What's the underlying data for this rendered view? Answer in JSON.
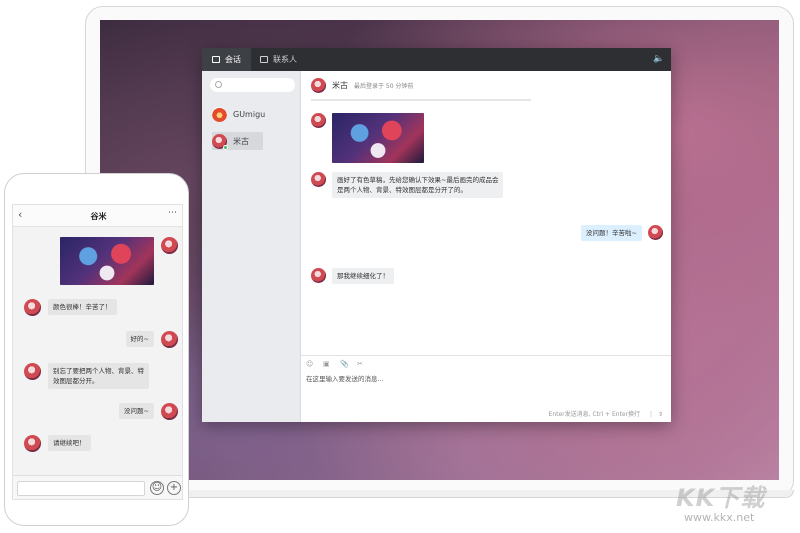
{
  "desktop": {
    "tabs": [
      {
        "label": "会话",
        "icon": "chat-icon",
        "active": true
      },
      {
        "label": "联系人",
        "icon": "contacts-icon",
        "active": false
      }
    ],
    "contacts": [
      {
        "name": "GUmigu",
        "selected": false
      },
      {
        "name": "米古",
        "selected": true
      }
    ],
    "chat": {
      "name": "米古",
      "status": "最后登录于  50 分钟前"
    },
    "messages": [
      {
        "from": "other",
        "type": "image"
      },
      {
        "from": "other",
        "text_line1": "画好了有色草稿，先给您确认下效果~最后画完的成品会",
        "text_line2": "是两个人物、背景、特效图层都是分开了的。"
      },
      {
        "from": "me",
        "text": "没问题！辛苦啦~"
      },
      {
        "from": "other",
        "text": "那我继续细化了！"
      }
    ],
    "editor": {
      "placeholder": "在这里输入要发送的消息...",
      "hint": "Enter发送消息, Ctrl + Enter换行",
      "tools": [
        "emoji-icon",
        "image-icon",
        "attach-icon",
        "scissors-icon"
      ]
    }
  },
  "phone": {
    "title": "谷米",
    "messages": [
      {
        "from": "me",
        "type": "image"
      },
      {
        "from": "other",
        "text": "颜色很棒！辛苦了！"
      },
      {
        "from": "me",
        "text": "好的~"
      },
      {
        "from": "other",
        "text_line1": "别忘了要把两个人物、背景、特",
        "text_line2": "效图层都分开。"
      },
      {
        "from": "me",
        "text": "没问题~"
      },
      {
        "from": "other",
        "text": "请继续吧！"
      }
    ]
  },
  "watermark": {
    "logo": "KK下载",
    "url": "www.kkx.net"
  },
  "colors": {
    "titlebar": "#2d2f33",
    "sidebar": "#e9ebee",
    "my_bubble": "#dcefff",
    "other_bubble": "#eeeff1"
  }
}
